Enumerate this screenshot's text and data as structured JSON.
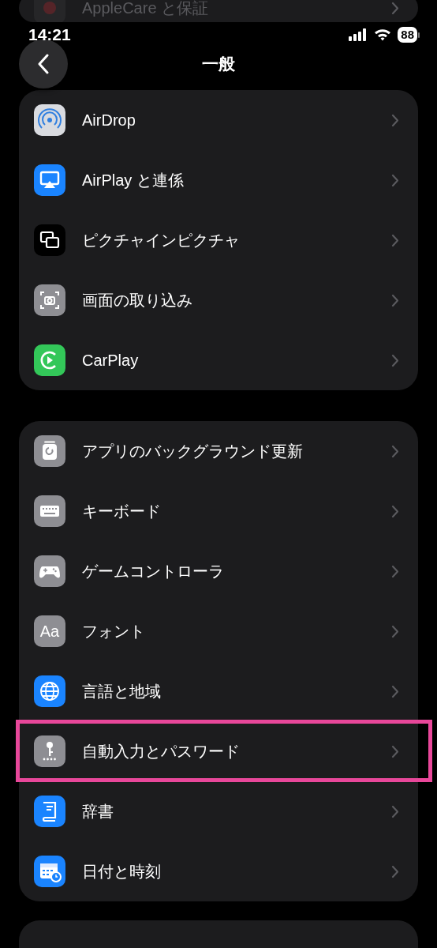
{
  "status_bar": {
    "time": "14:21",
    "battery": "88"
  },
  "nav_bar": {
    "title": "一般"
  },
  "groups": [
    {
      "items": [
        {
          "label": "AppleCare と保証"
        }
      ]
    },
    {
      "items": [
        {
          "label": "AirDrop",
          "highlighted": false
        },
        {
          "label": "AirPlay と連係",
          "highlighted": false
        },
        {
          "label": "ピクチャインピクチャ",
          "highlighted": false
        },
        {
          "label": "画面の取り込み",
          "highlighted": false
        },
        {
          "label": "CarPlay",
          "highlighted": false
        }
      ]
    },
    {
      "items": [
        {
          "label": "アプリのバックグラウンド更新",
          "highlighted": false
        },
        {
          "label": "キーボード",
          "highlighted": false
        },
        {
          "label": "ゲームコントローラ",
          "highlighted": false
        },
        {
          "label": "フォント",
          "icon_text": "Aa",
          "highlighted": false
        },
        {
          "label": "言語と地域",
          "highlighted": false
        },
        {
          "label": "自動入力とパスワード",
          "highlighted": true
        },
        {
          "label": "辞書",
          "highlighted": false
        },
        {
          "label": "日付と時刻",
          "highlighted": false
        }
      ]
    }
  ]
}
